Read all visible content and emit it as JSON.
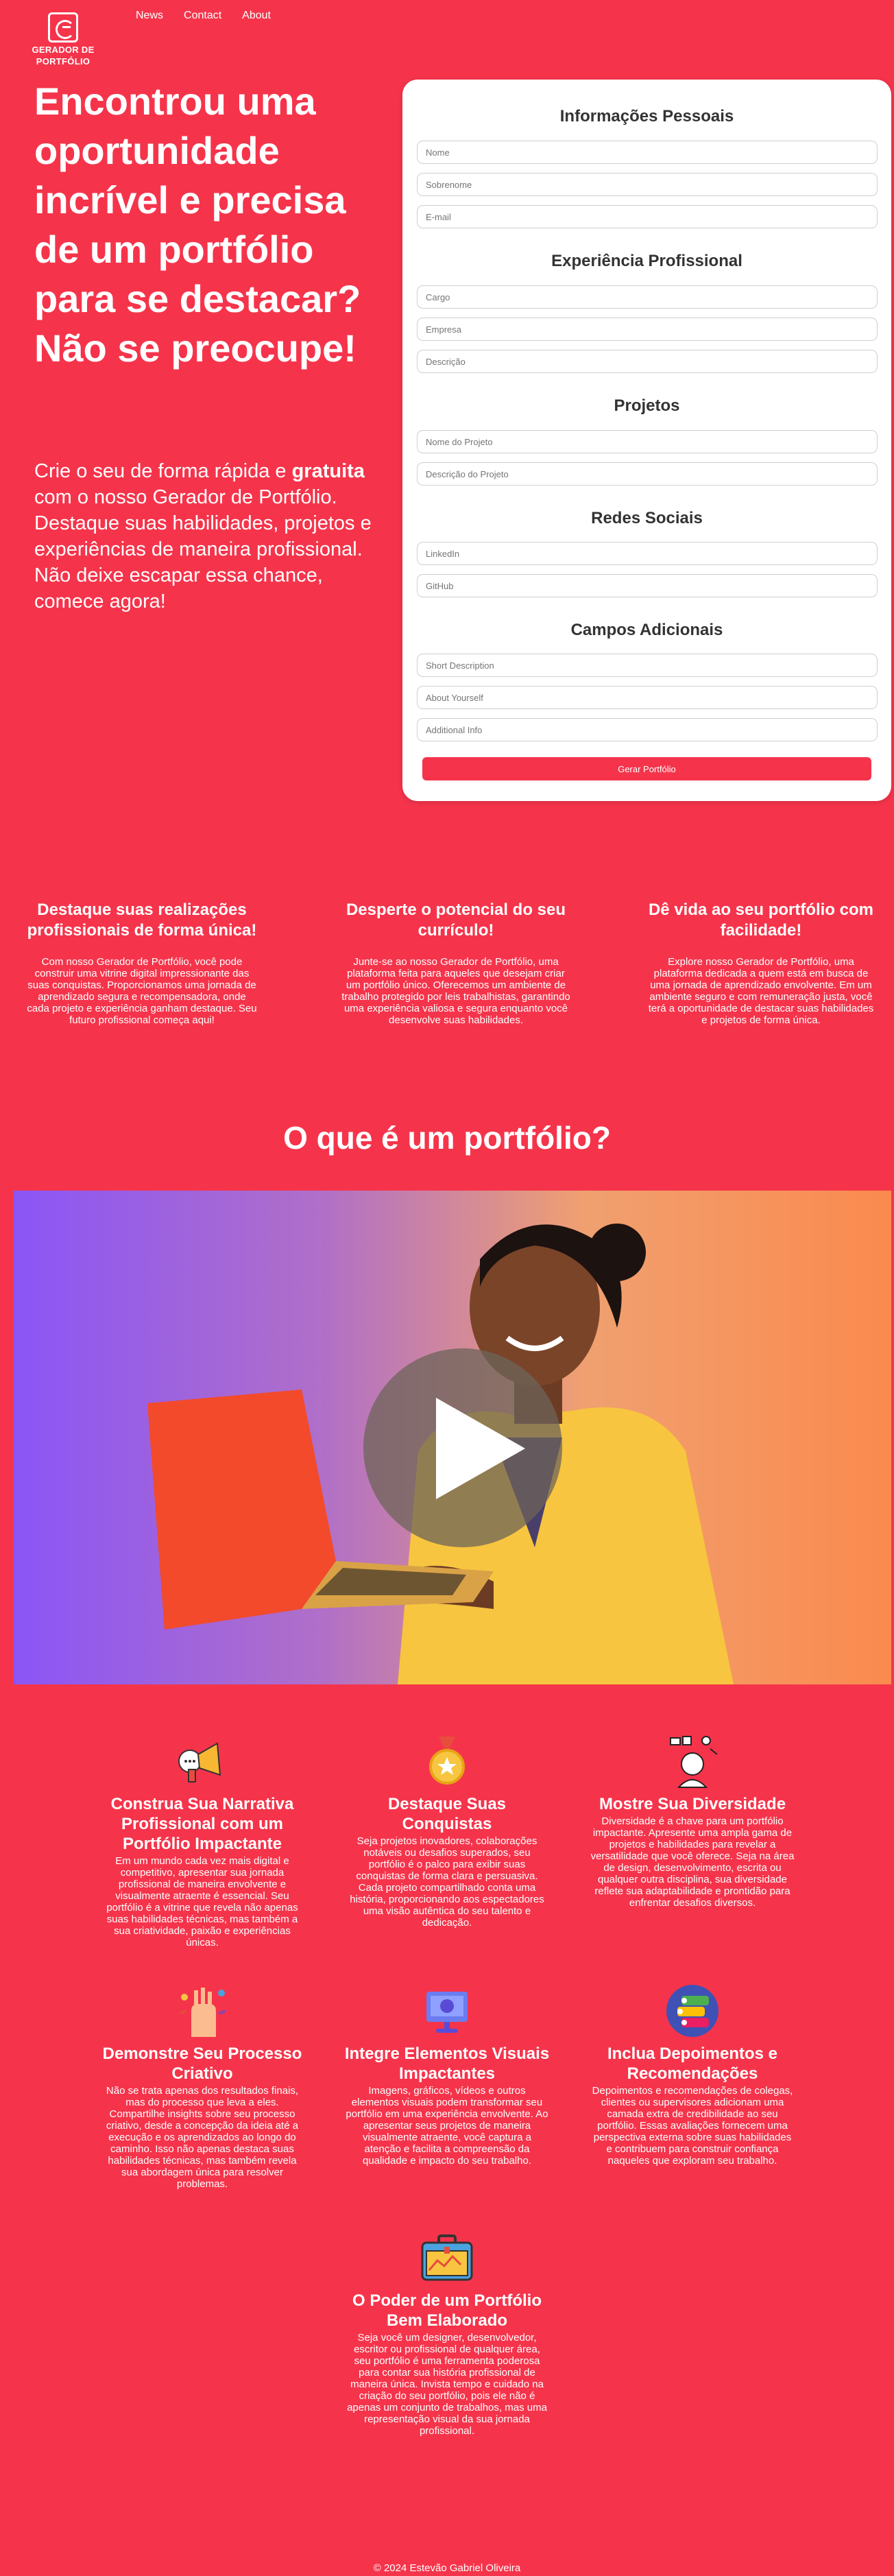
{
  "nav": {
    "logo_line1": "GERADOR DE",
    "logo_line2": "PORTFÓLIO",
    "links": [
      "News",
      "Contact",
      "About"
    ]
  },
  "hero": {
    "title": "Encontrou uma oportunidade incrível e precisa de um portfólio para se destacar? Não se preocupe!",
    "text_before": "Crie o seu de forma rápida e ",
    "text_bold": "gratuita",
    "text_after": " com o nosso Gerador de Portfólio. Destaque suas habilidades, projetos e experiências de maneira profissional. Não deixe escapar essa chance, comece agora!"
  },
  "form": {
    "sections": {
      "personal": "Informações Pessoais",
      "experience": "Experiência Profissional",
      "projects": "Projetos",
      "social": "Redes Sociais",
      "additional": "Campos Adicionais"
    },
    "placeholders": {
      "name": "Nome",
      "surname": "Sobrenome",
      "email": "E-mail",
      "role": "Cargo",
      "company": "Empresa",
      "description": "Descrição",
      "project_name": "Nome do Projeto",
      "project_description": "Descrição do Projeto",
      "linkedin": "LinkedIn",
      "github": "GitHub",
      "short_description": "Short Description",
      "about": "About Yourself",
      "additional_info": "Additional Info"
    },
    "submit_label": "Gerar Portfólio"
  },
  "features": [
    {
      "title": "Destaque suas realizações profissionais de forma única!",
      "text": "Com nosso Gerador de Portfólio, você pode construir uma vitrine digital impressionante das suas conquistas. Proporcionamos uma jornada de aprendizado segura e recompensadora, onde cada projeto e experiência ganham destaque. Seu futuro profissional começa aqui!"
    },
    {
      "title": "Desperte o potencial do seu currículo!",
      "text": "Junte-se ao nosso Gerador de Portfólio, uma plataforma feita para aqueles que desejam criar um portfólio único. Oferecemos um ambiente de trabalho protegido por leis trabalhistas, garantindo uma experiência valiosa e segura enquanto você desenvolve suas habilidades."
    },
    {
      "title": "Dê vida ao seu portfólio com facilidade!",
      "text": "Explore nosso Gerador de Portfólio, uma plataforma dedicada a quem está em busca de uma jornada de aprendizado envolvente. Em um ambiente seguro e com remuneração justa, você terá a oportunidade de destacar suas habilidades e projetos de forma única."
    }
  ],
  "portfolio_heading": "O que é um portfólio?",
  "cards": [
    {
      "icon": "megaphone-icon",
      "title": "Construa Sua Narrativa Profissional com um Portfólio Impactante",
      "text": "Em um mundo cada vez mais digital e competitivo, apresentar sua jornada profissional de maneira envolvente e visualmente atraente é essencial. Seu portfólio é a vitrine que revela não apenas suas habilidades técnicas, mas também a sua criatividade, paixão e experiências únicas."
    },
    {
      "icon": "medal-icon",
      "title": "Destaque Suas Conquistas",
      "text": "Seja projetos inovadores, colaborações notáveis ou desafios superados, seu portfólio é o palco para exibir suas conquistas de forma clara e persuasiva. Cada projeto compartilhado conta uma história, proporcionando aos espectadores uma visão autêntica do seu talento e dedicação."
    },
    {
      "icon": "diversity-icon",
      "title": "Mostre Sua Diversidade",
      "text": "Diversidade é a chave para um portfólio impactante. Apresente uma ampla gama de projetos e habilidades para revelar a versatilidade que você oferece. Seja na área de design, desenvolvimento, escrita ou qualquer outra disciplina, sua diversidade reflete sua adaptabilidade e prontidão para enfrentar desafios diversos."
    },
    {
      "icon": "creative-process-icon",
      "title": "Demonstre Seu Processo Criativo",
      "text": "Não se trata apenas dos resultados finais, mas do processo que leva a eles. Compartilhe insights sobre seu processo criativo, desde a concepção da ideia até a execução e os aprendizados ao longo do caminho. Isso não apenas destaca suas habilidades técnicas, mas também revela sua abordagem única para resolver problemas."
    },
    {
      "icon": "visual-elements-icon",
      "title": "Integre Elementos Visuais Impactantes",
      "text": "Imagens, gráficos, vídeos e outros elementos visuais podem transformar seu portfólio em uma experiência envolvente. Ao apresentar seus projetos de maneira visualmente atraente, você captura a atenção e facilita a compreensão da qualidade e impacto do seu trabalho."
    },
    {
      "icon": "testimonials-icon",
      "title": "Inclua Depoimentos e Recomendações",
      "text": "Depoimentos e recomendações de colegas, clientes ou supervisores adicionam uma camada extra de credibilidade ao seu portfólio. Essas avaliações fornecem uma perspectiva externa sobre suas habilidades e contribuem para construir confiança naqueles que exploram seu trabalho."
    },
    {
      "icon": "briefcase-icon",
      "title": "O Poder de um Portfólio Bem Elaborado",
      "text": "Seja você um designer, desenvolvedor, escritor ou profissional de qualquer área, seu portfólio é uma ferramenta poderosa para contar sua história profissional de maneira única. Invista tempo e cuidado na criação do seu portfólio, pois ele não é apenas um conjunto de trabalhos, mas uma representação visual da sua jornada profissional."
    }
  ],
  "footer": "© 2024 Estevão Gabriel Oliveira"
}
